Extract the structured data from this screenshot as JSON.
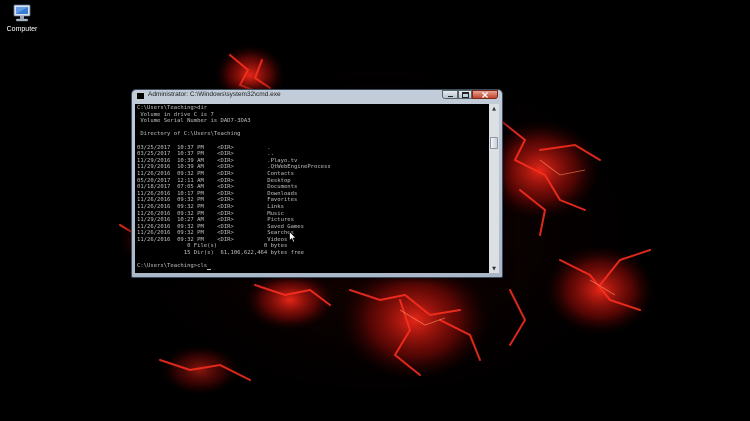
{
  "desktop": {
    "icons": [
      {
        "label": "Computer",
        "icon": "computer-icon"
      }
    ],
    "wallpaper": {
      "description_colors": {
        "background": "#000000",
        "accent": "#c0120c"
      }
    }
  },
  "window": {
    "title": "Administrator: C:\\Windows\\system32\\cmd.exe",
    "controls": {
      "minimize": "minimize-icon",
      "maximize": "maximize-icon",
      "close": "close-icon"
    }
  },
  "console": {
    "lines": [
      "C:\\Users\\Teaching>dir",
      " Volume in drive C is 7",
      " Volume Serial Number is DAD7-3DA3",
      "",
      " Directory of C:\\Users\\Teaching",
      "",
      "03/25/2017  10:37 PM    <DIR>          .",
      "03/25/2017  10:37 PM    <DIR>          ..",
      "11/29/2016  10:39 AM    <DIR>          .Playo.tv",
      "11/29/2016  10:39 AM    <DIR>          .QtWebEngineProcess",
      "11/26/2016  09:32 PM    <DIR>          Contacts",
      "05/20/2017  12:11 AM    <DIR>          Desktop",
      "01/18/2017  07:05 AM    <DIR>          Documents",
      "11/26/2016  10:17 PM    <DIR>          Downloads",
      "11/26/2016  09:32 PM    <DIR>          Favorites",
      "11/26/2016  09:32 PM    <DIR>          Links",
      "11/26/2016  09:32 PM    <DIR>          Music",
      "11/29/2016  10:27 AM    <DIR>          Pictures",
      "11/26/2016  09:32 PM    <DIR>          Saved Games",
      "11/26/2016  09:32 PM    <DIR>          Searches",
      "11/26/2016  09:32 PM    <DIR>          Videos",
      "               0 File(s)              0 bytes",
      "              15 Dir(s)  61,106,622,464 bytes free",
      ""
    ],
    "prompt": "C:\\Users\\Teaching>cls",
    "colors": {
      "background": "#000000",
      "text": "#c0c0c0"
    }
  }
}
